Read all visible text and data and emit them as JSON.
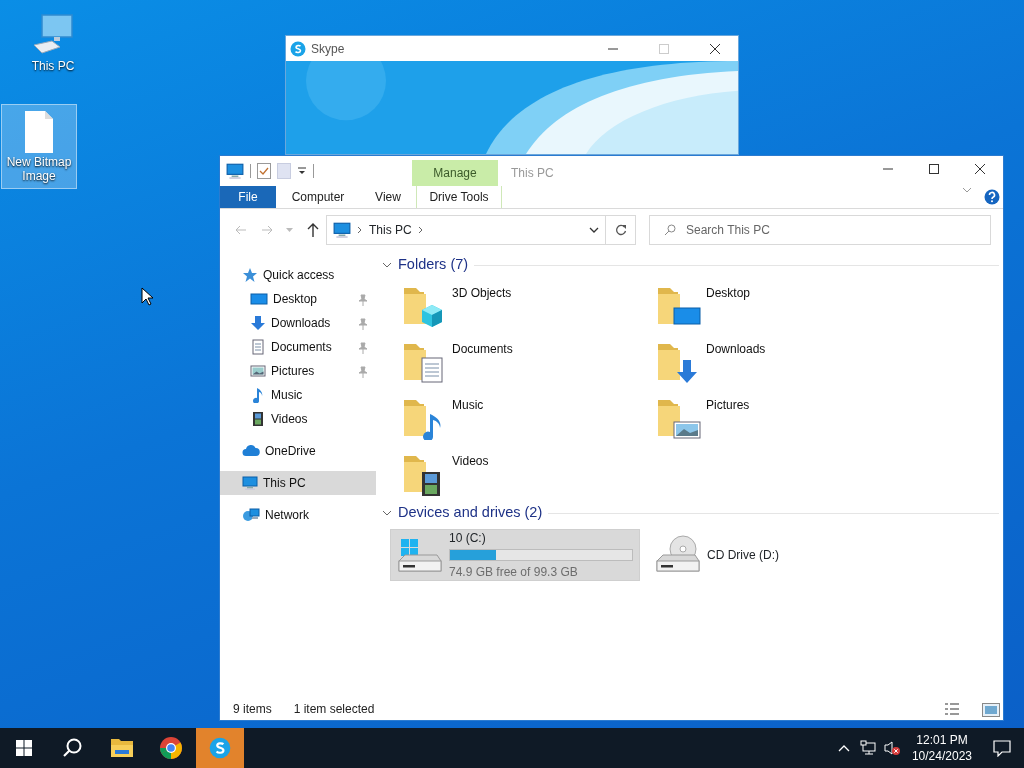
{
  "desktop_icons": [
    {
      "label": "This PC",
      "kind": "pc",
      "selected": false
    },
    {
      "label": "New Bitmap Image",
      "kind": "file",
      "selected": true
    }
  ],
  "skype_window": {
    "title": "Skype"
  },
  "explorer": {
    "title": "This PC",
    "contextual_group": "Manage",
    "ribbon_tabs": [
      {
        "label": "File",
        "kind": "file"
      },
      {
        "label": "Computer",
        "kind": "tab"
      },
      {
        "label": "View",
        "kind": "tab"
      },
      {
        "label": "Drive Tools",
        "kind": "contextual"
      }
    ],
    "address": {
      "crumbs": [
        "This PC"
      ]
    },
    "search": {
      "placeholder": "Search This PC"
    },
    "nav": [
      {
        "label": "Quick access",
        "kind": "star",
        "selected": false,
        "children": [
          {
            "label": "Desktop",
            "kind": "desktop",
            "pinned": true,
            "selected": false
          },
          {
            "label": "Downloads",
            "kind": "downloads",
            "pinned": true,
            "selected": false
          },
          {
            "label": "Documents",
            "kind": "documents",
            "pinned": true,
            "selected": false
          },
          {
            "label": "Pictures",
            "kind": "pictures",
            "pinned": true,
            "selected": false
          },
          {
            "label": "Music",
            "kind": "music",
            "pinned": false,
            "selected": false
          },
          {
            "label": "Videos",
            "kind": "videos",
            "pinned": false,
            "selected": false
          }
        ]
      },
      {
        "label": "OneDrive",
        "kind": "cloud",
        "selected": false
      },
      {
        "label": "This PC",
        "kind": "pc",
        "selected": true
      },
      {
        "label": "Network",
        "kind": "network",
        "selected": false
      }
    ],
    "folders": {
      "title": "Folders (7)",
      "items": [
        {
          "label": "3D Objects",
          "kind": "cube"
        },
        {
          "label": "Desktop",
          "kind": "desktop"
        },
        {
          "label": "Documents",
          "kind": "documents"
        },
        {
          "label": "Downloads",
          "kind": "downloads"
        },
        {
          "label": "Music",
          "kind": "music"
        },
        {
          "label": "Pictures",
          "kind": "pictures"
        },
        {
          "label": "Videos",
          "kind": "videos"
        }
      ]
    },
    "drives": {
      "title": "Devices and drives (2)",
      "items": [
        {
          "label": "10 (C:)",
          "kind": "system",
          "selected": true,
          "level": 0.25,
          "space": "74.9 GB free of 99.3 GB"
        },
        {
          "label": "CD Drive (D:)",
          "kind": "cd",
          "selected": false
        }
      ]
    },
    "status": {
      "count": "9 items",
      "selection": "1 item selected"
    }
  },
  "taskbar": {
    "apps": [
      {
        "kind": "start",
        "flashing": false
      },
      {
        "kind": "search",
        "flashing": false
      },
      {
        "kind": "explorer",
        "flashing": false
      },
      {
        "kind": "chrome",
        "flashing": false
      },
      {
        "kind": "skype",
        "flashing": true
      }
    ],
    "time": "12:01 PM",
    "date": "10/24/2023"
  }
}
